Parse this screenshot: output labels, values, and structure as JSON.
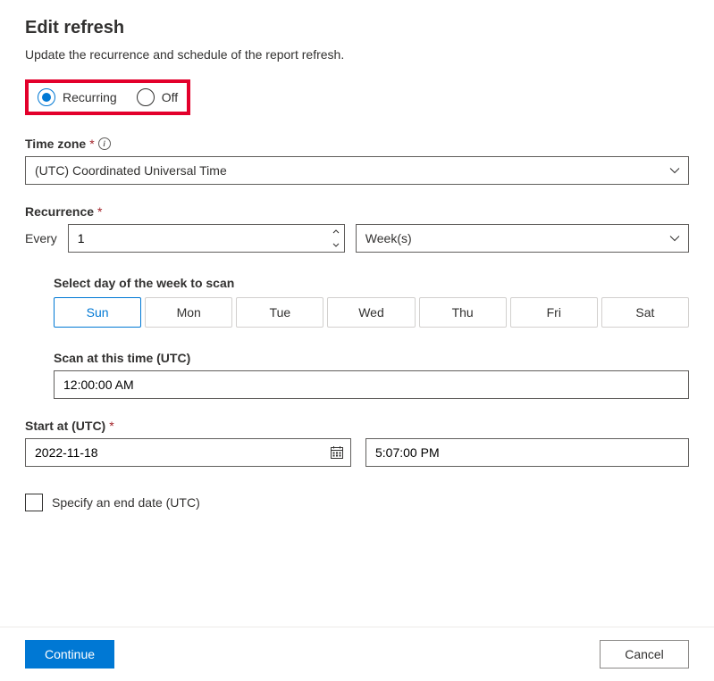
{
  "title": "Edit refresh",
  "subtitle": "Update the recurrence and schedule of the report refresh.",
  "radio": {
    "recurring": "Recurring",
    "off": "Off"
  },
  "timezone": {
    "label": "Time zone",
    "value": "(UTC) Coordinated Universal Time"
  },
  "recurrence": {
    "label": "Recurrence",
    "every": "Every",
    "count": "1",
    "unit": "Week(s)"
  },
  "daySelect": {
    "label": "Select day of the week to scan",
    "days": [
      "Sun",
      "Mon",
      "Tue",
      "Wed",
      "Thu",
      "Fri",
      "Sat"
    ],
    "selected": "Sun"
  },
  "scanTime": {
    "label": "Scan at this time (UTC)",
    "value": "12:00:00 AM"
  },
  "startAt": {
    "label": "Start at (UTC)",
    "date": "2022-11-18",
    "time": "5:07:00 PM"
  },
  "endDate": {
    "label": "Specify an end date (UTC)"
  },
  "footer": {
    "continue": "Continue",
    "cancel": "Cancel"
  }
}
